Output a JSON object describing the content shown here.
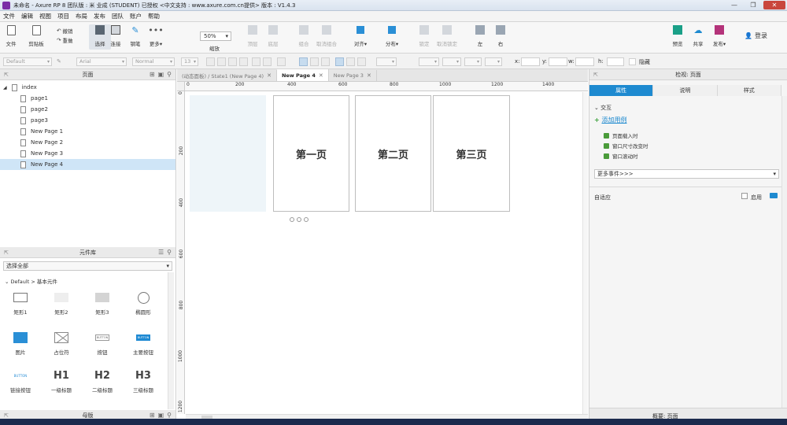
{
  "window": {
    "title": "未命名 - Axure RP 8 团队版 : 米 业成 (STUDENT) 已授权      <中文支持 : www.axure.com.cn提供> 版本 : V1.4.3",
    "controls": [
      "—",
      "❐",
      "✕"
    ]
  },
  "menu": [
    "文件",
    "编辑",
    "视图",
    "项目",
    "布局",
    "发布",
    "团队",
    "账户",
    "帮助"
  ],
  "toolbar": {
    "file": "文件",
    "clipboard": "剪贴板",
    "undo": "撤销",
    "redo": "重做",
    "select": "选择",
    "connect": "连接",
    "pen": "钢笔",
    "more": "更多▾",
    "zoom_value": "50%",
    "zoom_label": "缩放",
    "top": "顶层",
    "bottom": "底层",
    "group": "组合",
    "ungroup": "取消组合",
    "align": "对齐▾",
    "distribute": "分布▾",
    "lock": "锁定",
    "unlock": "取消锁定",
    "left": "左",
    "right": "右",
    "preview": "预览",
    "share": "共享",
    "publish": "发布▾",
    "login": "登录"
  },
  "format_bar": {
    "style": "Default",
    "font": "Arial",
    "weight": "Normal",
    "size": "13",
    "x_label": "x:",
    "y_label": "y:",
    "w_label": "w:",
    "h_label": "h:",
    "hidden": "隐藏"
  },
  "pages_panel": {
    "title": "页面",
    "items": [
      {
        "label": "index",
        "level": 0
      },
      {
        "label": "page1",
        "level": 1
      },
      {
        "label": "page2",
        "level": 1
      },
      {
        "label": "page3",
        "level": 1
      },
      {
        "label": "New Page 1",
        "level": 1
      },
      {
        "label": "New Page 2",
        "level": 1
      },
      {
        "label": "New Page 3",
        "level": 1
      },
      {
        "label": "New Page 4",
        "level": 1,
        "selected": true
      }
    ]
  },
  "library_panel": {
    "title": "元件库",
    "select": "选择全部",
    "category": "Default > 基本元件",
    "widgets": [
      {
        "label": "矩形1",
        "icon": "rect"
      },
      {
        "label": "矩形2",
        "icon": "rect2"
      },
      {
        "label": "矩形3",
        "icon": "rect3"
      },
      {
        "label": "椭圆形",
        "icon": "ellipse"
      },
      {
        "label": "图片",
        "icon": "image"
      },
      {
        "label": "占位符",
        "icon": "placeholder"
      },
      {
        "label": "按钮",
        "icon": "button",
        "text": "BUTTON"
      },
      {
        "label": "主要按钮",
        "icon": "primary-button",
        "text": "BUTTON"
      },
      {
        "label": "链接按钮",
        "icon": "link-button",
        "text": "BUTTON"
      },
      {
        "label": "一级标题",
        "icon": "h1",
        "text": "H1"
      },
      {
        "label": "二级标题",
        "icon": "h2",
        "text": "H2"
      },
      {
        "label": "三级标题",
        "icon": "h3",
        "text": "H3"
      }
    ]
  },
  "masters_panel": {
    "title": "母版"
  },
  "tabs": [
    {
      "label": "(动态面板) / State1 (New Page 4)",
      "active": false
    },
    {
      "label": "New Page 4",
      "active": true
    },
    {
      "label": "New Page 3",
      "active": false
    }
  ],
  "rulers": {
    "top": [
      "0",
      "200",
      "400",
      "600",
      "800",
      "1000",
      "1200",
      "1400"
    ],
    "left": [
      "0",
      "200",
      "400",
      "600",
      "800",
      "1000",
      "1200"
    ]
  },
  "canvas": {
    "frames": [
      "第一页",
      "第二页",
      "第三页"
    ]
  },
  "inspector": {
    "title": "检视: 页面",
    "tabs": [
      "属性",
      "说明",
      "样式"
    ],
    "interaction": "交互",
    "add_case": "添加用例",
    "events": [
      "页面载入时",
      "窗口尺寸改变时",
      "窗口滚动时"
    ],
    "more_events": "更多事件>>>",
    "adaptive": "自适应",
    "enable": "启用",
    "bottom_tab": "概要: 页面"
  },
  "colors": {
    "accent": "#1e8ad0",
    "selected_row": "#cfe5f7",
    "taskbar": "#1b2a4d"
  }
}
